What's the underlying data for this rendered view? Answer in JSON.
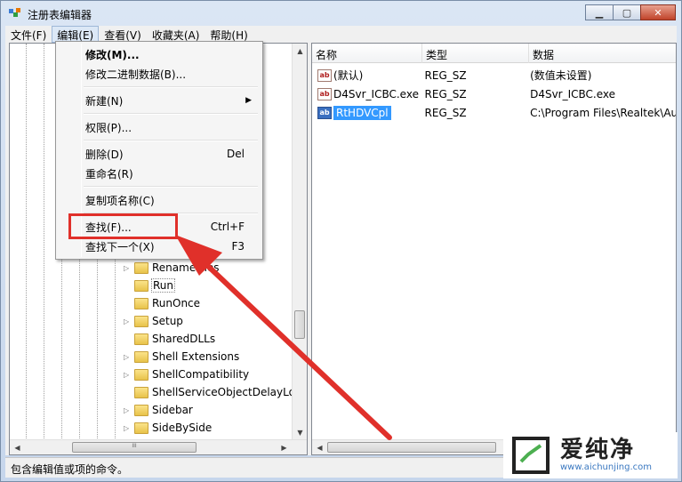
{
  "window": {
    "title": "注册表编辑器",
    "buttons": {
      "minimize": "▁",
      "maximize": "▢",
      "close": "✕"
    }
  },
  "menubar": [
    "文件(F)",
    "编辑(E)",
    "查看(V)",
    "收藏夹(A)",
    "帮助(H)"
  ],
  "edit_menu": {
    "modify": "修改(M)...",
    "modify_binary": "修改二进制数据(B)...",
    "new": "新建(N)",
    "permissions": "权限(P)...",
    "delete": "删除(D)",
    "delete_shortcut": "Del",
    "rename": "重命名(R)",
    "copy_key_name": "复制项名称(C)",
    "find": "查找(F)...",
    "find_shortcut": "Ctrl+F",
    "find_next": "查找下一个(X)",
    "find_next_shortcut": "F3"
  },
  "tree": {
    "items": [
      "RenameFiles",
      "Run",
      "RunOnce",
      "Setup",
      "SharedDLLs",
      "Shell Extensions",
      "ShellCompatibility",
      "ShellServiceObjectDelayLoa",
      "Sidebar",
      "SideBySide"
    ],
    "selected": "Run",
    "hscroll_grip": "III"
  },
  "list": {
    "columns": [
      "名称",
      "类型",
      "数据"
    ],
    "rows": [
      {
        "name": "(默认)",
        "type": "REG_SZ",
        "data": "(数值未设置)"
      },
      {
        "name": "D4Svr_ICBC.exe",
        "type": "REG_SZ",
        "data": "D4Svr_ICBC.exe"
      },
      {
        "name": "RtHDVCpl",
        "type": "REG_SZ",
        "data": "C:\\Program Files\\Realtek\\Au"
      }
    ],
    "icon_text": "ab"
  },
  "statusbar": {
    "text": "包含编辑值或项的命令。"
  },
  "watermark": {
    "brand": "爱纯净",
    "url": "www.aichunjing.com"
  },
  "colors": {
    "highlight_box": "#e0302a",
    "arrow": "#e0302a",
    "selection": "#3399ff"
  }
}
